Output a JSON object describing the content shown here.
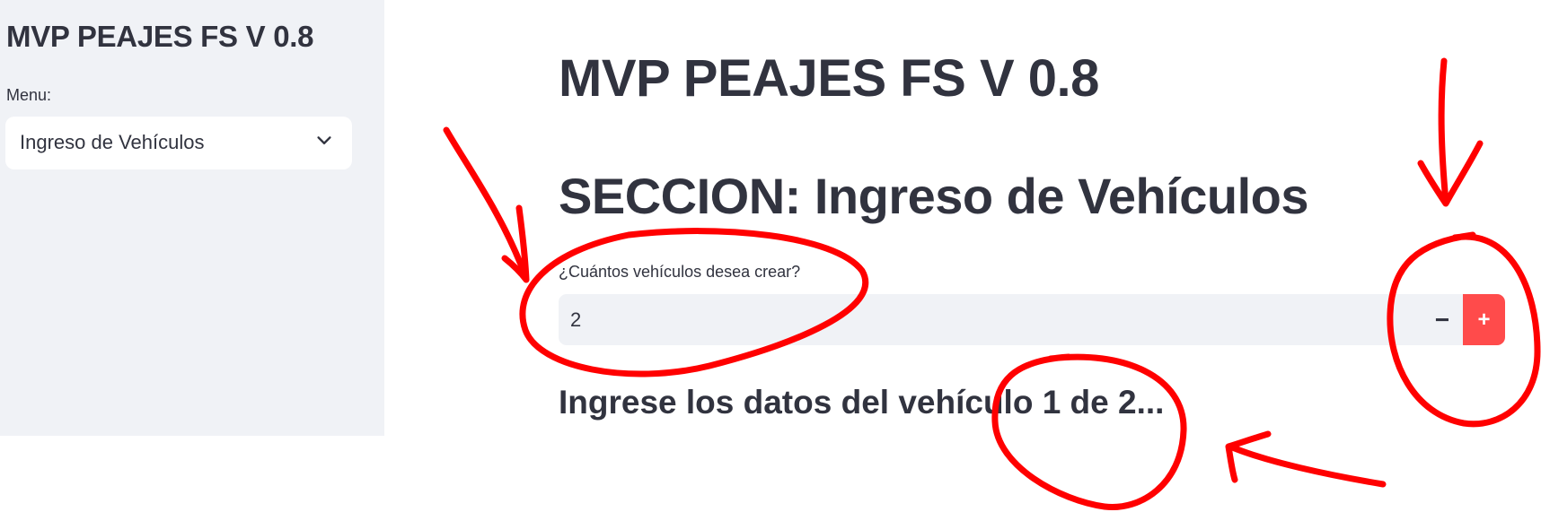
{
  "sidebar": {
    "title": "MVP PEAJES FS V 0.8",
    "menu_label": "Menu:",
    "menu_selected": "Ingreso de Vehículos",
    "menu_icon": "chevron-down-icon"
  },
  "main": {
    "title": "MVP PEAJES FS V 0.8",
    "section_title": "SECCION: Ingreso de Vehículos",
    "vehicle_count": {
      "label": "¿Cuántos vehículos desea crear?",
      "value": "2",
      "decrement_label": "−",
      "increment_label": "+"
    },
    "subheader": "Ingrese los datos del vehículo 1 de 2..."
  },
  "colors": {
    "sidebar_bg": "#f0f2f6",
    "text": "#31333f",
    "accent": "#ff4b4b",
    "annotation": "#ff0000"
  }
}
